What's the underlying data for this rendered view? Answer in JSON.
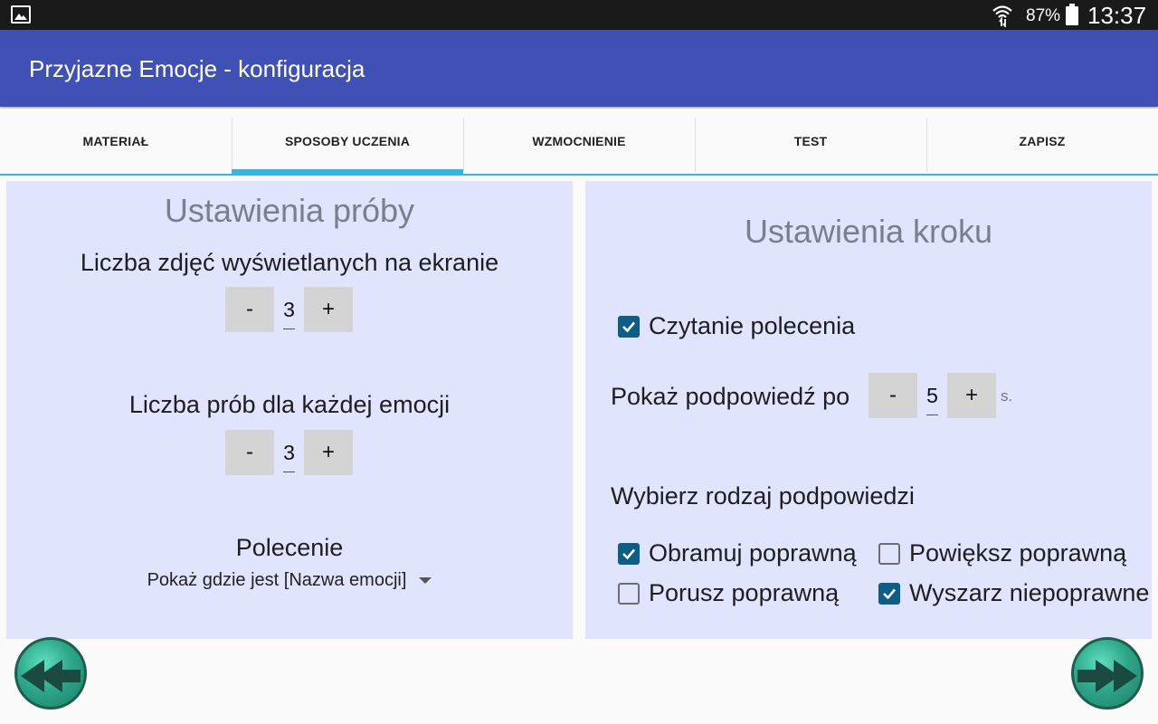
{
  "status_bar": {
    "battery": "87%",
    "time": "13:37",
    "icons": [
      "gallery-icon",
      "wifi-icon",
      "battery-icon"
    ]
  },
  "app_bar": {
    "title": "Przyjazne Emocje - konfiguracja"
  },
  "tabs": [
    {
      "label": "MATERIAŁ",
      "active": false
    },
    {
      "label": "SPOSOBY UCZENIA",
      "active": true
    },
    {
      "label": "WZMOCNIENIE",
      "active": false
    },
    {
      "label": "TEST",
      "active": false
    },
    {
      "label": "ZAPISZ",
      "active": false
    }
  ],
  "left_panel": {
    "heading": "Ustawienia próby",
    "photos_label": "Liczba zdjęć wyświetlanych na ekranie",
    "photos_stepper": {
      "minus": "-",
      "value": "3",
      "plus": "+"
    },
    "trials_label": "Liczba prób dla każdej emocji",
    "trials_stepper": {
      "minus": "-",
      "value": "3",
      "plus": "+"
    },
    "command_label": "Polecenie",
    "command_value": "Pokaż gdzie jest [Nazwa emocji]"
  },
  "right_panel": {
    "heading": "Ustawienia kroku",
    "read_command": {
      "label": "Czytanie polecenia",
      "checked": true
    },
    "hint_label": "Pokaż podpowiedź po",
    "hint_stepper": {
      "minus": "-",
      "value": "5",
      "plus": "+"
    },
    "hint_unit": "s.",
    "hint_type_label": "Wybierz rodzaj podpowiedzi",
    "hint_options": [
      {
        "label": "Obramuj poprawną",
        "checked": true
      },
      {
        "label": "Powiększ poprawną",
        "checked": false
      },
      {
        "label": "Porusz poprawną",
        "checked": false
      },
      {
        "label": "Wyszarz niepoprawne",
        "checked": true
      }
    ]
  },
  "colors": {
    "app_bar": "#3f51b5",
    "tab_indicator": "#33b5e5",
    "panel_bg": "#e0e4fc",
    "checkbox": "#0d5e86",
    "nav_button": "#2ea78a"
  }
}
